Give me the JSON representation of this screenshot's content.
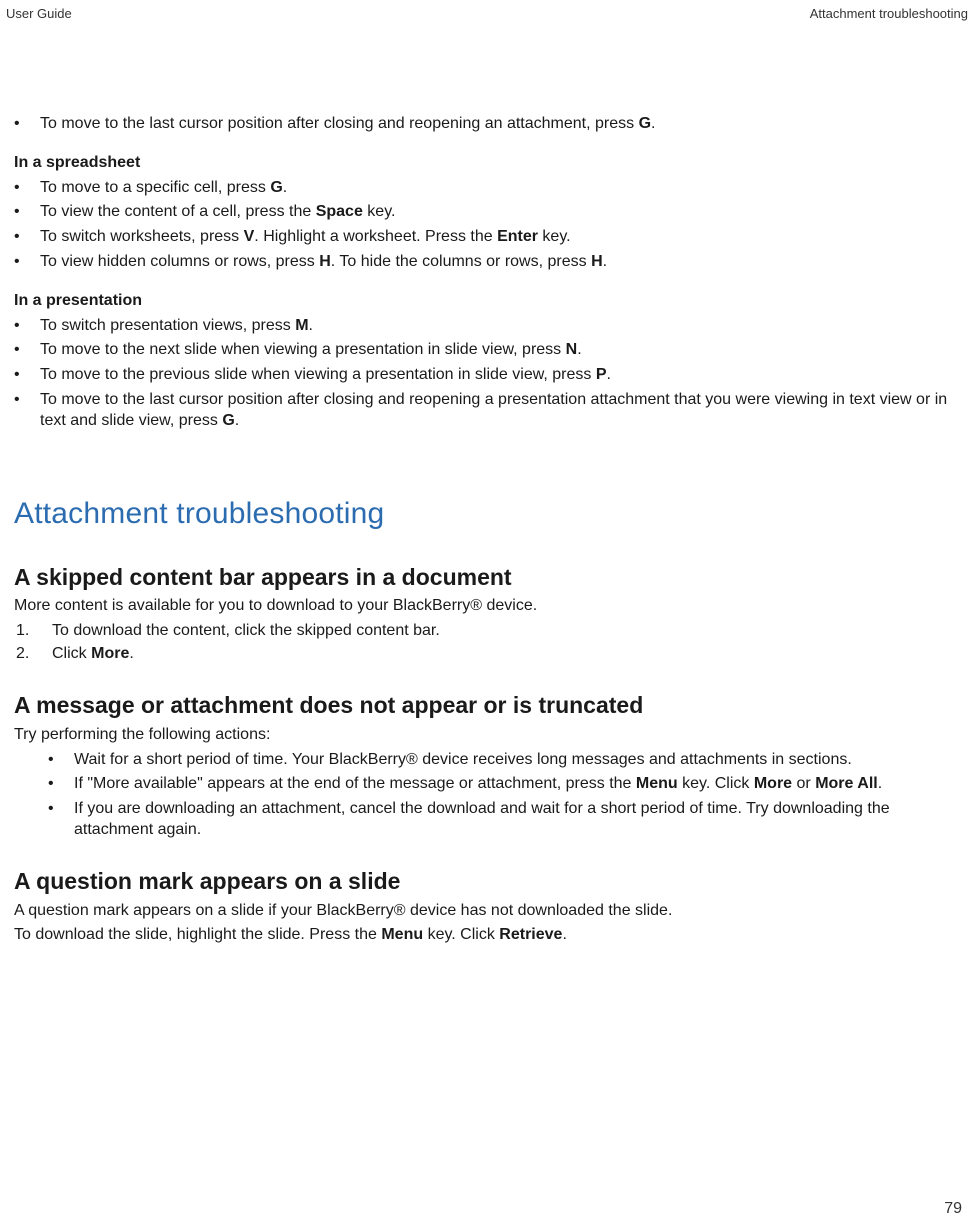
{
  "header": {
    "left": "User Guide",
    "right": "Attachment troubleshooting"
  },
  "footer": {
    "page_number": "79"
  },
  "top_bullets": [
    {
      "pre": "To move to the last cursor position after closing and reopening an attachment, press ",
      "k1": "G",
      "post": "."
    }
  ],
  "spreadsheet": {
    "heading": "In a spreadsheet",
    "items": [
      {
        "pre": "To move to a specific cell, press ",
        "k1": "G",
        "post": "."
      },
      {
        "pre": "To view the content of a cell, press the ",
        "k1": "Space",
        "post": " key."
      },
      {
        "pre": "To switch worksheets, press ",
        "k1": "V",
        "mid": ". Highlight a worksheet. Press the ",
        "k2": "Enter",
        "post": " key."
      },
      {
        "pre": "To view hidden columns or rows, press ",
        "k1": "H",
        "mid": ". To hide the columns or rows, press ",
        "k2": "H",
        "post": "."
      }
    ]
  },
  "presentation": {
    "heading": "In a presentation",
    "items": [
      {
        "pre": "To switch presentation views, press ",
        "k1": "M",
        "post": "."
      },
      {
        "pre": "To move to the next slide when viewing a presentation in slide view, press ",
        "k1": "N",
        "post": "."
      },
      {
        "pre": "To move to the previous slide when viewing a presentation in slide view, press ",
        "k1": "P",
        "post": "."
      },
      {
        "pre": "To move to the last cursor position after closing and reopening a presentation attachment that you were viewing in text view or in text and slide view, press ",
        "k1": "G",
        "post": "."
      }
    ]
  },
  "section_title": "Attachment troubleshooting",
  "topic1": {
    "heading": "A skipped content bar appears in a document",
    "intro": "More content is available for you to download to your BlackBerry® device.",
    "steps": [
      {
        "n": "1.",
        "text": "To download the content, click the skipped content bar."
      },
      {
        "n": "2.",
        "pre": "Click ",
        "k1": "More",
        "post": "."
      }
    ]
  },
  "topic2": {
    "heading": "A message or attachment does not appear or is truncated",
    "intro": "Try performing the following actions:",
    "items": [
      {
        "text": "Wait for a short period of time. Your BlackBerry® device receives long messages and attachments in sections."
      },
      {
        "pre": "If \"More available\" appears at the end of the message or attachment, press the ",
        "k1": "Menu",
        "mid": " key. Click ",
        "k2": "More",
        "mid2": " or ",
        "k3": "More All",
        "post": "."
      },
      {
        "text": "If you are downloading an attachment, cancel the download and wait for a short period of time. Try downloading the attachment again."
      }
    ]
  },
  "topic3": {
    "heading": "A question mark appears on a slide",
    "para1": "A question mark appears on a slide if your BlackBerry® device has not downloaded the slide.",
    "para2": {
      "pre": "To download the slide, highlight the slide. Press the ",
      "k1": "Menu",
      "mid": " key. Click ",
      "k2": "Retrieve",
      "post": "."
    }
  }
}
